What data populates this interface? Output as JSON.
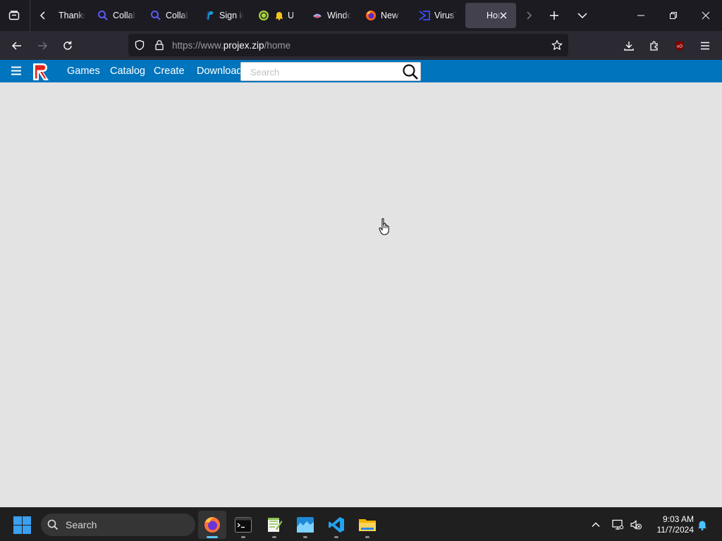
{
  "browser": {
    "tabs": [
      {
        "title": "Thanks",
        "favicon": "thanks-favicon"
      },
      {
        "title": "Collab",
        "favicon": "search-favicon"
      },
      {
        "title": "Collab",
        "favicon": "search-favicon"
      },
      {
        "title": "Sign in",
        "favicon": "paypal-favicon"
      },
      {
        "title": "U",
        "favicon": "bell-favicon"
      },
      {
        "title": "Windows",
        "favicon": "windows-favicon"
      },
      {
        "title": "New Tab",
        "favicon": "firefox-favicon"
      },
      {
        "title": "VirusTotal",
        "favicon": "virustotal-favicon"
      },
      {
        "title": "Home",
        "favicon": "none",
        "active": true
      }
    ],
    "url_prefix": "https://www.",
    "url_host": "projex.zip",
    "url_path": "/home"
  },
  "site": {
    "nav": [
      "Games",
      "Catalog",
      "Create",
      "Download"
    ],
    "search_placeholder": "Search",
    "accent": "#0074bd"
  },
  "taskbar": {
    "search_label": "Search",
    "apps": [
      "firefox",
      "terminal",
      "notepad-plus-plus",
      "app-blue",
      "vscode",
      "file-explorer"
    ],
    "time": "9:03 AM",
    "date": "11/7/2024"
  }
}
